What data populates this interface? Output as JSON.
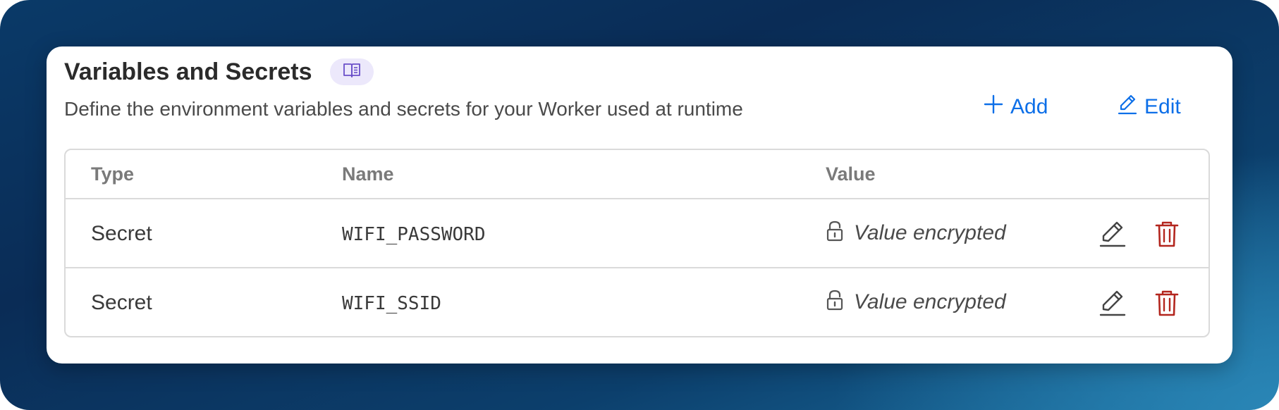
{
  "panel": {
    "title": "Variables and Secrets",
    "docs_icon": "book-open-icon",
    "subtitle": "Define the environment variables and secrets for your Worker used at runtime",
    "add_label": "Add",
    "edit_label": "Edit"
  },
  "table": {
    "headers": {
      "type": "Type",
      "name": "Name",
      "value": "Value"
    },
    "rows": [
      {
        "type": "Secret",
        "name": "WIFI_PASSWORD",
        "value": "Value encrypted"
      },
      {
        "type": "Secret",
        "name": "WIFI_SSID",
        "value": "Value encrypted"
      }
    ]
  },
  "colors": {
    "accent": "#0d6fe8",
    "danger": "#b3261e",
    "docs_pill_bg": "#ece8fb",
    "docs_icon": "#6a4fc9"
  }
}
